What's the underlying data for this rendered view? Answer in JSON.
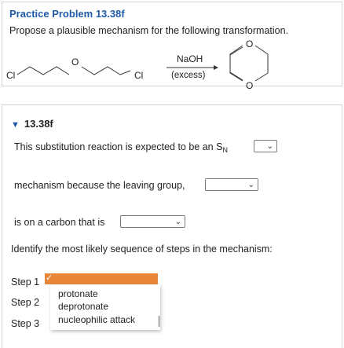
{
  "problem": {
    "title": "Practice Problem 13.38f",
    "description": "Propose a plausible mechanism for the following transformation.",
    "scheme": {
      "reactant_left_cl": "Cl",
      "reactant_o": "O",
      "reactant_right_cl": "Cl",
      "reagent": "NaOH",
      "reagent_note": "(excess)",
      "product_o_top": "O",
      "product_o_bottom": "O"
    }
  },
  "part": {
    "caret": "▼",
    "label": "13.38f",
    "line1": "This substitution reaction is expected to be an S",
    "line1_sub": "N",
    "line2": "mechanism because the leaving group,",
    "line3": "is on a carbon that is",
    "instruction": "Identify the most likely sequence of steps in the mechanism:",
    "select_chevron": "⌄"
  },
  "steps": [
    {
      "label": "Step 1"
    },
    {
      "label": "Step 2"
    },
    {
      "label": "Step 3"
    }
  ],
  "dropdown": {
    "checkmark": "✓",
    "options": [
      "protonate",
      "deprotonate",
      "nucleophilic attack"
    ]
  }
}
